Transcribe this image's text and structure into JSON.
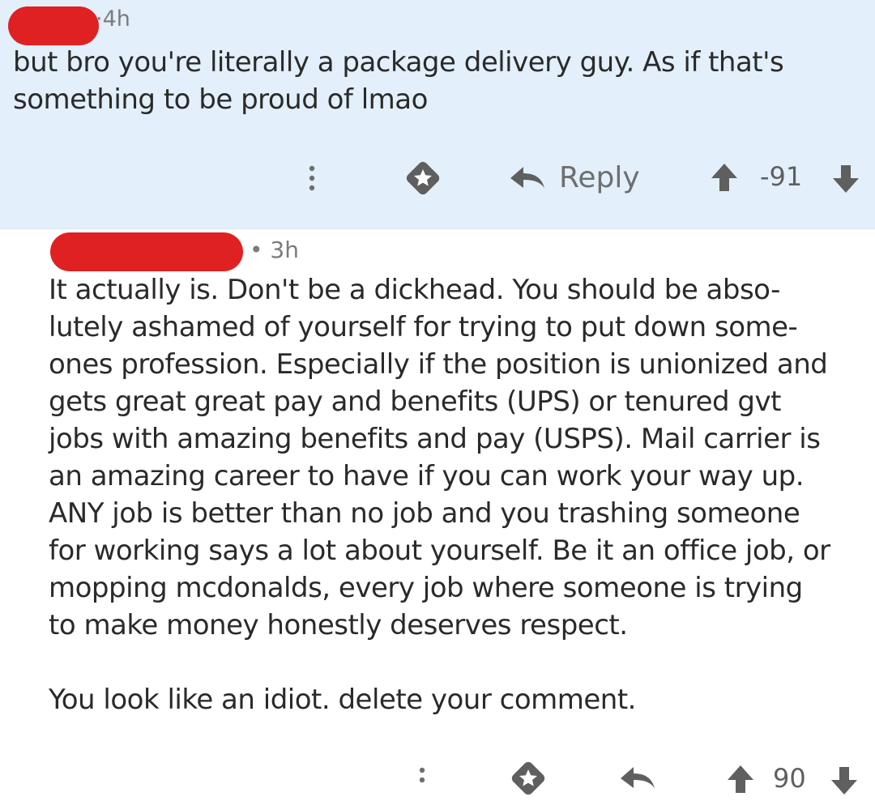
{
  "parent_comment": {
    "time": "4h",
    "body_lines": [
      "but bro you're literally a package delivery guy. As if that's",
      "something to be proud of lmao"
    ],
    "actions": {
      "more_icon": "vertical-ellipsis",
      "award_icon": "award-badge",
      "reply_icon": "reply-arrow",
      "reply_label": "Reply",
      "upvote_icon": "up-arrow",
      "score": "-91",
      "downvote_icon": "down-arrow"
    }
  },
  "reply_comment": {
    "time": "3h",
    "paragraph1_lines": [
      "It actually is. Don't be a dickhead. You should be abso-",
      "lutely ashamed of yourself for trying to put down some-",
      "ones profession. Especially if the position is unionized and",
      "gets great great pay and benefits (UPS) or tenured gvt",
      "jobs with amazing benefits and pay (USPS). Mail carrier is",
      "an amazing career to have if you can work your way up.",
      "ANY job is better than no job and you trashing someone",
      "for working says a lot about yourself. Be it an office job, or",
      "mopping mcdonalds, every job where someone is trying",
      "to make money honestly deserves respect."
    ],
    "paragraph2": "You look like an idiot. delete your comment.",
    "actions": {
      "score": "90"
    }
  },
  "colors": {
    "parent_bg": "#e3f0fb",
    "redaction": "#e02121",
    "text": "#2a2a2a",
    "meta": "#7c7c7c",
    "icons": "#5f5f5f"
  }
}
